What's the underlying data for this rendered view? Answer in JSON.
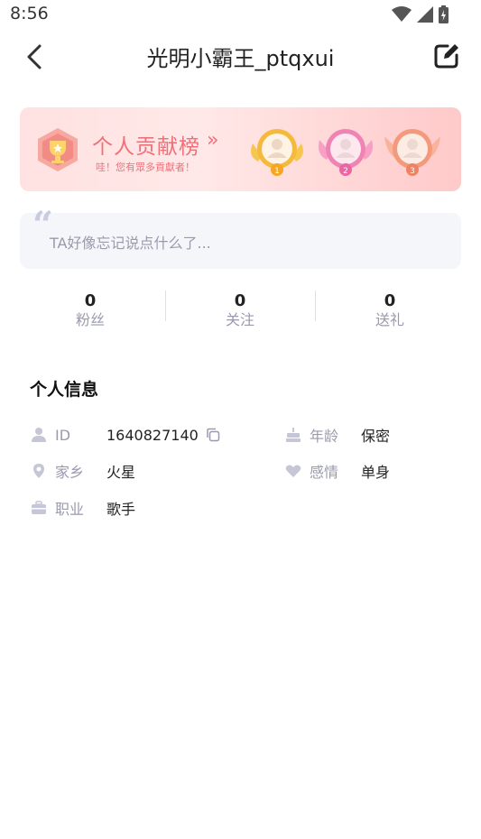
{
  "status": {
    "time": "8:56"
  },
  "nav": {
    "title": "光明小霸王_ptqxui"
  },
  "contribution": {
    "title": "个人贡献榜",
    "arrow": "»",
    "subtitle": "哇！您有眾多貢獻者！",
    "ranks": [
      "1",
      "2",
      "3"
    ]
  },
  "signature": {
    "text": "TA好像忘记说点什么了..."
  },
  "stats": [
    {
      "value": "0",
      "label": "粉丝"
    },
    {
      "value": "0",
      "label": "关注"
    },
    {
      "value": "0",
      "label": "送礼"
    }
  ],
  "info": {
    "title": "个人信息",
    "id_label": "ID",
    "id_value": "1640827140",
    "age_label": "年龄",
    "age_value": "保密",
    "hometown_label": "家乡",
    "hometown_value": "火星",
    "relationship_label": "感情",
    "relationship_value": "单身",
    "job_label": "职业",
    "job_value": "歌手"
  },
  "colors": {
    "accent": "#f0707a",
    "muted": "#9a9aae",
    "icon": "#c5c7d6"
  }
}
